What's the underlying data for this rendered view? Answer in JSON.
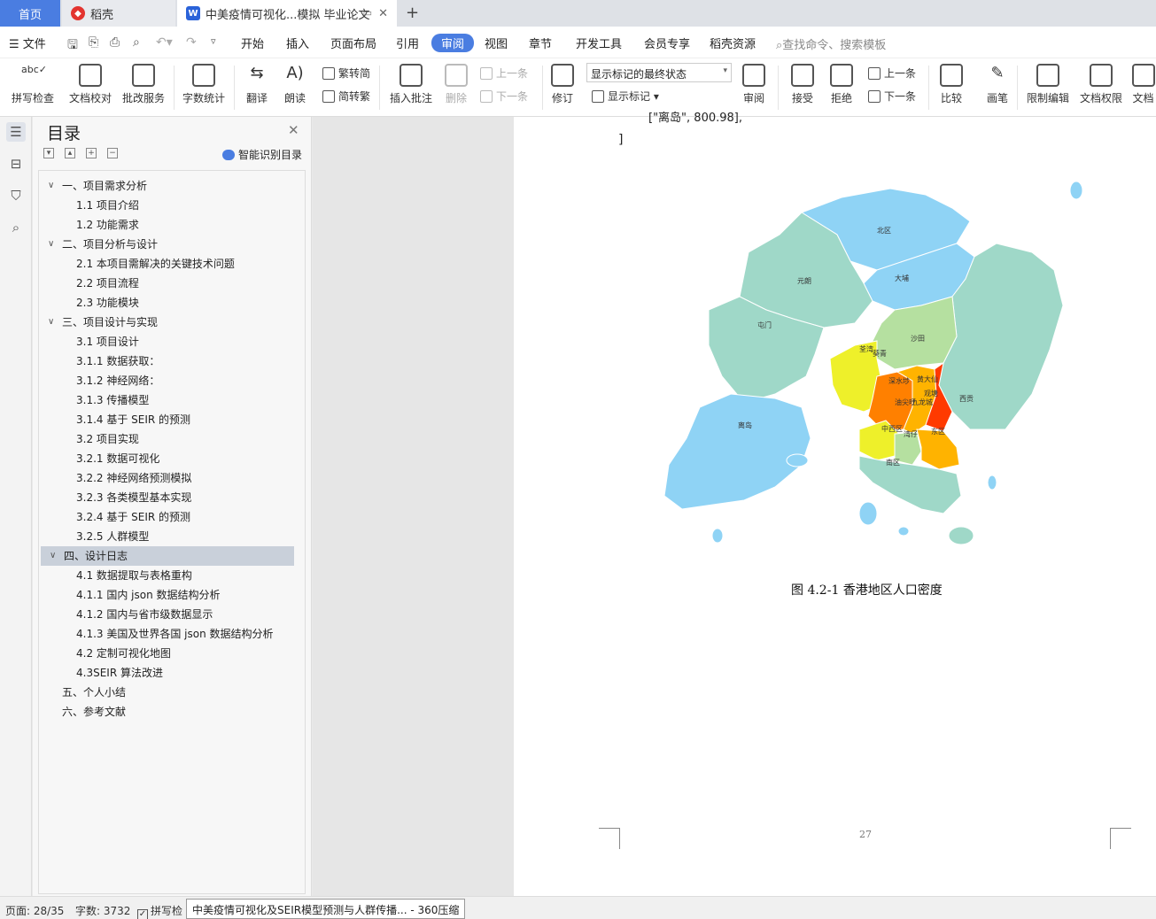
{
  "tabs": {
    "home": "首页",
    "docer": "稻壳",
    "doc": "中美疫情可视化...模拟 毕业论文",
    "docer_icon": "docer-logo-icon",
    "doc_icon": "writer-doc-icon"
  },
  "menu": {
    "file": "文件",
    "items": [
      "开始",
      "插入",
      "页面布局",
      "引用",
      "审阅",
      "视图",
      "章节",
      "开发工具",
      "会员专享",
      "稻壳资源"
    ],
    "active": "审阅",
    "search": "查找命令、搜索模板"
  },
  "ribbon": {
    "spell_check": "拼写检查",
    "doc_proof": "文档校对",
    "batch_service": "批改服务",
    "word_count": "字数统计",
    "translate": "翻译",
    "read_aloud": "朗读",
    "to_traditional": "简转繁",
    "trad_to_simp": "繁转简",
    "insert_comment": "插入批注",
    "delete": "删除",
    "prev_comment": "上一条",
    "next_comment": "下一条",
    "track_changes": "修订",
    "markup_state": "显示标记的最终状态",
    "show_markup": "显示标记",
    "review": "审阅",
    "accept": "接受",
    "reject": "拒绝",
    "prev_change": "上一条",
    "next_change": "下一条",
    "compare": "比较",
    "ink": "画笔",
    "restrict_edit": "限制编辑",
    "doc_permission": "文档权限",
    "doc_cut": "文档"
  },
  "toc": {
    "title": "目录",
    "smart_label": "智能识别目录",
    "items": [
      {
        "label": "一、项目需求分析",
        "level": 1,
        "expanded": true
      },
      {
        "label": "1.1 项目介绍",
        "level": 2
      },
      {
        "label": "1.2 功能需求",
        "level": 2
      },
      {
        "label": "二、项目分析与设计",
        "level": 1,
        "expanded": true
      },
      {
        "label": "2.1 本项目需解决的关键技术问题",
        "level": 2
      },
      {
        "label": "2.2 项目流程",
        "level": 2
      },
      {
        "label": "2.3 功能模块",
        "level": 2
      },
      {
        "label": "三、项目设计与实现",
        "level": 1,
        "expanded": true
      },
      {
        "label": "3.1 项目设计",
        "level": 2
      },
      {
        "label": "3.1.1 数据获取：",
        "level": 2
      },
      {
        "label": "3.1.2 神经网络：",
        "level": 2
      },
      {
        "label": "3.1.3 传播模型",
        "level": 2
      },
      {
        "label": "3.1.4 基于 SEIR 的预测",
        "level": 2
      },
      {
        "label": "3.2 项目实现",
        "level": 2
      },
      {
        "label": "3.2.1 数据可视化",
        "level": 2
      },
      {
        "label": "3.2.2 神经网络预测模拟",
        "level": 2
      },
      {
        "label": "3.2.3 各类模型基本实现",
        "level": 2
      },
      {
        "label": "3.2.4 基于 SEIR 的预测",
        "level": 2
      },
      {
        "label": "3.2.5  人群模型",
        "level": 2
      },
      {
        "label": "四、设计日志",
        "level": 1,
        "expanded": true,
        "selected": true
      },
      {
        "label": "4.1 数据提取与表格重构",
        "level": 2
      },
      {
        "label": "4.1.1 国内 json 数据结构分析",
        "level": 2
      },
      {
        "label": "4.1.2 国内与省市级数据显示",
        "level": 2
      },
      {
        "label": "4.1.3 美国及世界各国 json 数据结构分析",
        "level": 2
      },
      {
        "label": "4.2 定制可视化地图",
        "level": 2
      },
      {
        "label": "4.3SEIR 算法改进",
        "level": 2
      },
      {
        "label": "五、个人小结",
        "level": 1
      },
      {
        "label": "六、参考文献",
        "level": 1
      }
    ]
  },
  "document": {
    "code_line1": "[\"离岛\", 800.98],",
    "code_line2": "]",
    "caption": "图 4.2-1  香港地区人口密度",
    "page_number": "27",
    "map_districts": [
      "北区",
      "大埔",
      "元朗",
      "屯门",
      "沙田",
      "荃湾",
      "葵青",
      "深水埗",
      "黄大仙",
      "观塘",
      "油尖旺",
      "九龙城",
      "西贡",
      "离岛",
      "中西区",
      "湾仔",
      "东区",
      "南区"
    ],
    "colors": {
      "low": "#8fd3f5",
      "lowmid": "#9fd8c8",
      "mid": "#b5e0a0",
      "midhigh": "#eef02a",
      "high": "#ffb300",
      "higher": "#ff8000",
      "highest": "#ff3a00"
    }
  },
  "status": {
    "page": "页面: 28/35",
    "words": "字数: 3732",
    "spell": "拼写检",
    "tooltip": "中美疫情可视化及SEIR模型预测与人群传播... - 360压缩"
  }
}
